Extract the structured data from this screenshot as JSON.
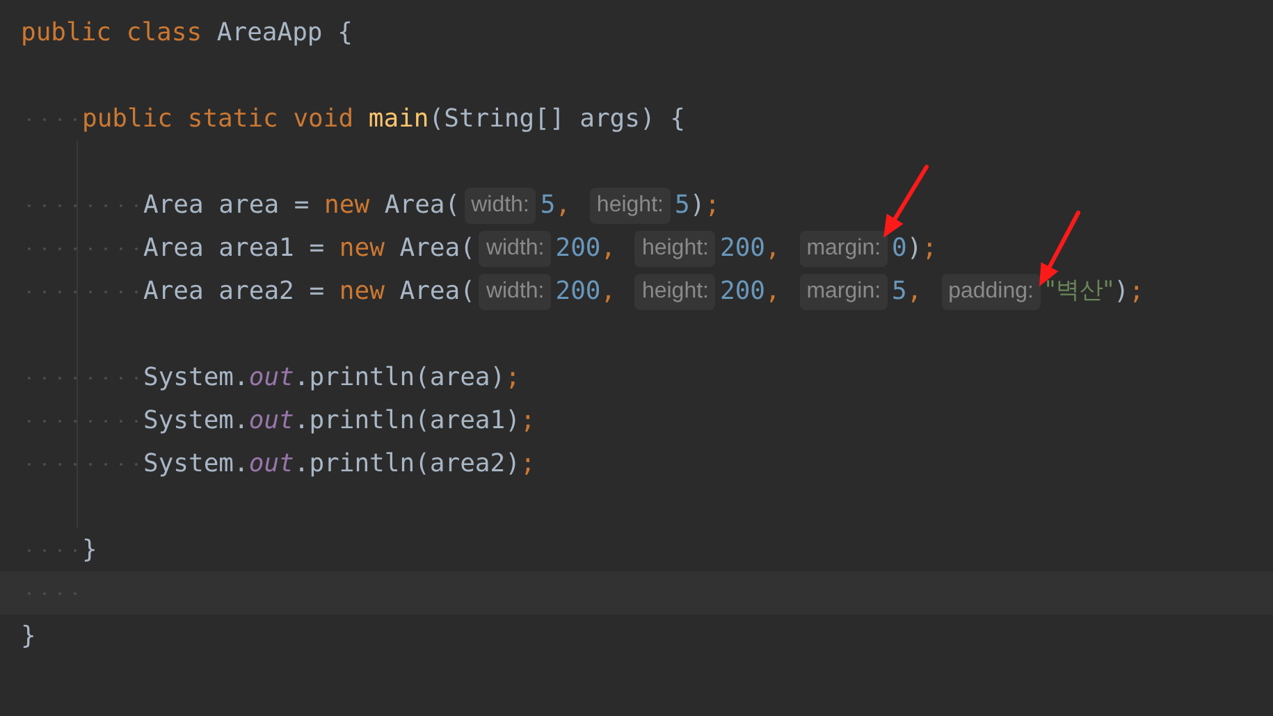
{
  "editor": {
    "lines": [
      {
        "kind": "code",
        "tokens": [
          {
            "kind": "keyword",
            "text": "public "
          },
          {
            "kind": "keyword",
            "text": "class "
          },
          {
            "kind": "plain",
            "text": "AreaApp {"
          }
        ],
        "children": [
          {
            "kind": "code"
          },
          {
            "kind": "code",
            "tokens": [
              {
                "kind": "keyword",
                "text": "public "
              },
              {
                "kind": "keyword",
                "text": "static "
              },
              {
                "kind": "keyword",
                "text": "void "
              },
              {
                "kind": "method",
                "text": "main"
              },
              {
                "kind": "plain",
                "text": "(String[] args) {"
              }
            ],
            "children": [
              {
                "kind": "code"
              },
              {
                "kind": "code",
                "tokens": [
                  {
                    "kind": "plain",
                    "text": "Area area = "
                  },
                  {
                    "kind": "keyword",
                    "text": "new "
                  },
                  {
                    "kind": "plain",
                    "text": "Area("
                  },
                  {
                    "kind": "hint",
                    "text": "width:"
                  },
                  {
                    "kind": "number",
                    "text": "5"
                  },
                  {
                    "kind": "punct",
                    "text": ", "
                  },
                  {
                    "kind": "hint",
                    "text": "height:"
                  },
                  {
                    "kind": "number",
                    "text": "5"
                  },
                  {
                    "kind": "plain",
                    "text": ")"
                  },
                  {
                    "kind": "punct",
                    "text": ";"
                  }
                ]
              },
              {
                "kind": "code",
                "tokens": [
                  {
                    "kind": "plain",
                    "text": "Area area1 = "
                  },
                  {
                    "kind": "keyword",
                    "text": "new "
                  },
                  {
                    "kind": "plain",
                    "text": "Area("
                  },
                  {
                    "kind": "hint",
                    "text": "width:"
                  },
                  {
                    "kind": "number",
                    "text": "200"
                  },
                  {
                    "kind": "punct",
                    "text": ", "
                  },
                  {
                    "kind": "hint",
                    "text": "height:"
                  },
                  {
                    "kind": "number",
                    "text": "200"
                  },
                  {
                    "kind": "punct",
                    "text": ", "
                  },
                  {
                    "kind": "hint",
                    "text": "margin:"
                  },
                  {
                    "kind": "number",
                    "text": "0"
                  },
                  {
                    "kind": "plain",
                    "text": ")"
                  },
                  {
                    "kind": "punct",
                    "text": ";"
                  }
                ]
              },
              {
                "kind": "code",
                "tokens": [
                  {
                    "kind": "plain",
                    "text": "Area area2 = "
                  },
                  {
                    "kind": "keyword",
                    "text": "new "
                  },
                  {
                    "kind": "plain",
                    "text": "Area("
                  },
                  {
                    "kind": "hint",
                    "text": "width:"
                  },
                  {
                    "kind": "number",
                    "text": "200"
                  },
                  {
                    "kind": "punct",
                    "text": ", "
                  },
                  {
                    "kind": "hint",
                    "text": "height:"
                  },
                  {
                    "kind": "number",
                    "text": "200"
                  },
                  {
                    "kind": "punct",
                    "text": ", "
                  },
                  {
                    "kind": "hint",
                    "text": "margin:"
                  },
                  {
                    "kind": "number",
                    "text": "5"
                  },
                  {
                    "kind": "punct",
                    "text": ", "
                  },
                  {
                    "kind": "hint",
                    "text": "padding:"
                  },
                  {
                    "kind": "string",
                    "text": "\"벽산\""
                  },
                  {
                    "kind": "plain",
                    "text": ")"
                  },
                  {
                    "kind": "punct",
                    "text": ";"
                  }
                ]
              },
              {
                "kind": "code"
              },
              {
                "kind": "code",
                "tokens": [
                  {
                    "kind": "plain",
                    "text": "System."
                  },
                  {
                    "kind": "field",
                    "text": "out"
                  },
                  {
                    "kind": "plain",
                    "text": ".println(area)"
                  },
                  {
                    "kind": "punct",
                    "text": ";"
                  }
                ]
              },
              {
                "kind": "code",
                "tokens": [
                  {
                    "kind": "plain",
                    "text": "System."
                  },
                  {
                    "kind": "field",
                    "text": "out"
                  },
                  {
                    "kind": "plain",
                    "text": ".println(area1)"
                  },
                  {
                    "kind": "punct",
                    "text": ";"
                  }
                ]
              },
              {
                "kind": "code",
                "tokens": [
                  {
                    "kind": "plain",
                    "text": "System."
                  },
                  {
                    "kind": "field",
                    "text": "out"
                  },
                  {
                    "kind": "plain",
                    "text": ".println(area2)"
                  },
                  {
                    "kind": "punct",
                    "text": ";"
                  }
                ]
              },
              {
                "kind": "code"
              }
            ]
          },
          {
            "kind": "code",
            "tokens": [
              {
                "kind": "plain",
                "text": "}"
              }
            ]
          },
          {
            "kind": "caret"
          }
        ]
      },
      {
        "kind": "code",
        "tokens": [
          {
            "kind": "plain",
            "text": "}"
          }
        ]
      }
    ]
  }
}
